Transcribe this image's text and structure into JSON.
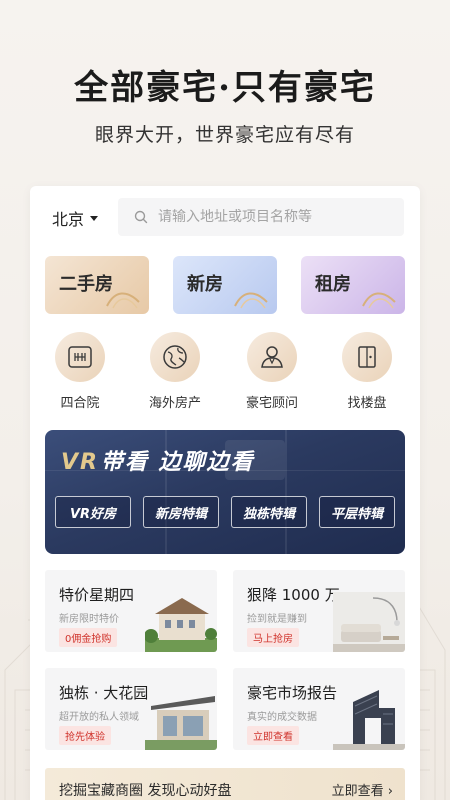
{
  "hero": {
    "title": "全部豪宅·只有豪宅",
    "subtitle": "眼界大开，世界豪宅应有尽有"
  },
  "search": {
    "city": "北京",
    "placeholder": "请输入地址或项目名称等"
  },
  "categories": [
    {
      "label": "二手房"
    },
    {
      "label": "新房"
    },
    {
      "label": "租房"
    }
  ],
  "quick_icons": [
    {
      "label": "四合院",
      "icon": "courtyard-icon"
    },
    {
      "label": "海外房产",
      "icon": "globe-icon"
    },
    {
      "label": "豪宅顾问",
      "icon": "advisor-icon"
    },
    {
      "label": "找楼盘",
      "icon": "building-search-icon"
    }
  ],
  "vr_banner": {
    "mark": "VR",
    "title": "带看 边聊边看",
    "buttons": [
      "VR好房",
      "新房特辑",
      "独栋特辑",
      "平层特辑"
    ]
  },
  "tiles": [
    {
      "title": "特价星期四",
      "subtitle": "新房限时特价",
      "tag": "0佣金抢购"
    },
    {
      "title": "狠降 1000 万",
      "subtitle": "捡到就是赚到",
      "tag": "马上抢房"
    },
    {
      "title": "独栋 · 大花园",
      "subtitle": "超开放的私人领域",
      "tag": "抢先体验"
    },
    {
      "title": "豪宅市场报告",
      "subtitle": "真实的成交数据",
      "tag": "立即查看"
    }
  ],
  "bottom_bar": {
    "text": "挖掘宝藏商圈  发现心动好盘",
    "link": "立即查看 ›"
  },
  "colors": {
    "tag_red": "#d0332c",
    "gold": "#e3c98d",
    "vr_bg": "#2b3a60"
  }
}
